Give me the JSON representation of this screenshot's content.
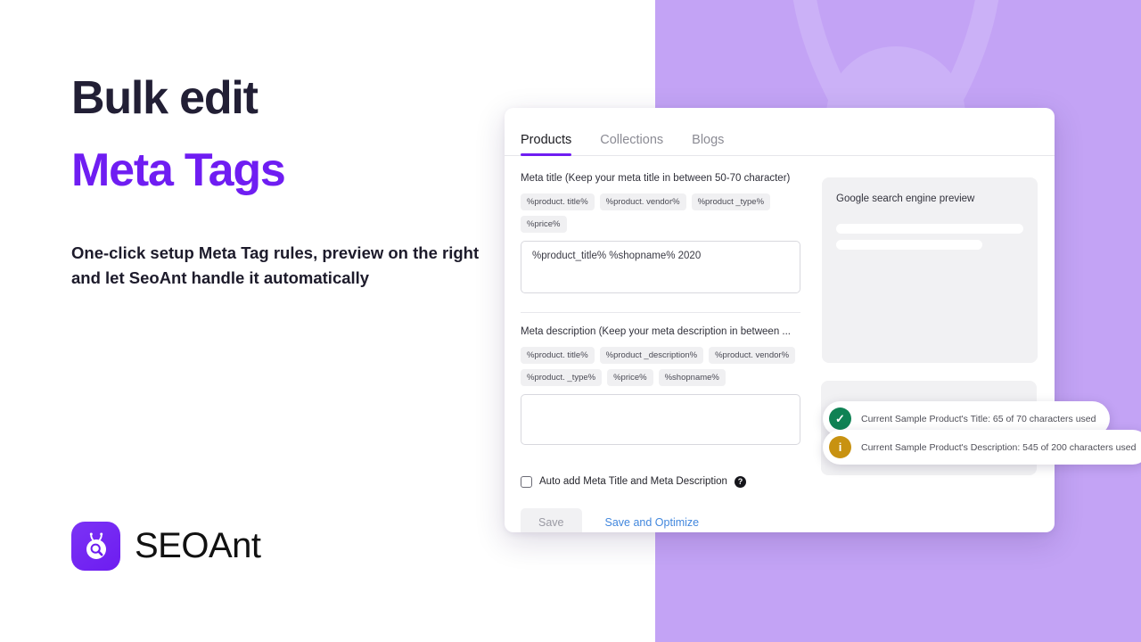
{
  "hero": {
    "title_line1": "Bulk edit",
    "title_line2": "Meta Tags",
    "subtitle": "One-click setup Meta Tag rules, preview on the right and let SeoAnt handle it automatically"
  },
  "brand": {
    "name": "SEOAnt",
    "mark_icon": "seoant-ant-magnifier-icon",
    "accent_color": "#6f1df2"
  },
  "colors": {
    "accent_purple": "#6f1df2",
    "panel_purple": "#c3a3f5",
    "link_blue": "#4287dd",
    "success_green": "#0f8254",
    "warning_amber": "#c89211"
  },
  "app": {
    "tabs": [
      {
        "label": "Products",
        "active": true
      },
      {
        "label": "Collections",
        "active": false
      },
      {
        "label": "Blogs",
        "active": false
      }
    ],
    "meta_title": {
      "label": "Meta title (Keep your meta title in between 50-70 character)",
      "tokens": [
        "%product. title%",
        "%product. vendor%",
        "%product _type%",
        "%price%"
      ],
      "value": "%product_title% %shopname% 2020",
      "placeholder": ""
    },
    "meta_description": {
      "label": "Meta description (Keep your meta description in between ...",
      "tokens": [
        "%product. title%",
        "%product _description%",
        "%product. vendor%",
        "%product. _type%",
        "%price%",
        "%shopname%"
      ],
      "value": "",
      "placeholder": ""
    },
    "auto_add": {
      "label": "Auto add Meta Title and Meta Description",
      "checked": false,
      "help_glyph": "?"
    },
    "actions": {
      "save_label": "Save",
      "optimize_label": "Save and Optimize"
    },
    "preview": {
      "title": "Google search engine preview"
    },
    "toasts": [
      {
        "icon": "check-circle-icon",
        "glyph": "✓",
        "color": "#0f8254",
        "text": "Current Sample Product's Title: 65 of 70 characters used"
      },
      {
        "icon": "info-circle-icon",
        "glyph": "i",
        "color": "#c89211",
        "text": "Current Sample Product's Description: 545 of 200 characters used"
      }
    ]
  }
}
